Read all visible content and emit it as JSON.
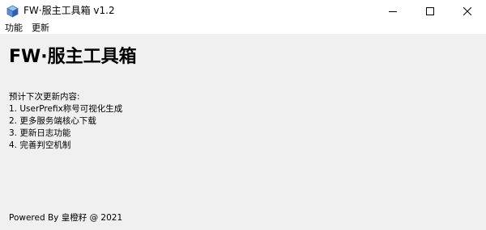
{
  "window": {
    "title": "FW·服主工具箱 v1.2",
    "icon": "app-box-icon",
    "controls": [
      "minimize-icon",
      "maximize-icon",
      "close-icon"
    ]
  },
  "menu": {
    "items": [
      "功能",
      "更新"
    ]
  },
  "main": {
    "heading": "FW·服主工具箱",
    "notes_title": "预计下次更新内容:",
    "notes": [
      "1. UserPrefix称号可视化生成",
      "2. 更多服务端核心下载",
      "3. 更新日志功能",
      "4. 完善判空机制"
    ],
    "footer": "Powered By 皇橙籽 @ 2021"
  },
  "colors": {
    "titlebar_bg": "#ffffff",
    "content_bg": "#f0f0f0",
    "icon_blue": "#5b8fd6"
  }
}
